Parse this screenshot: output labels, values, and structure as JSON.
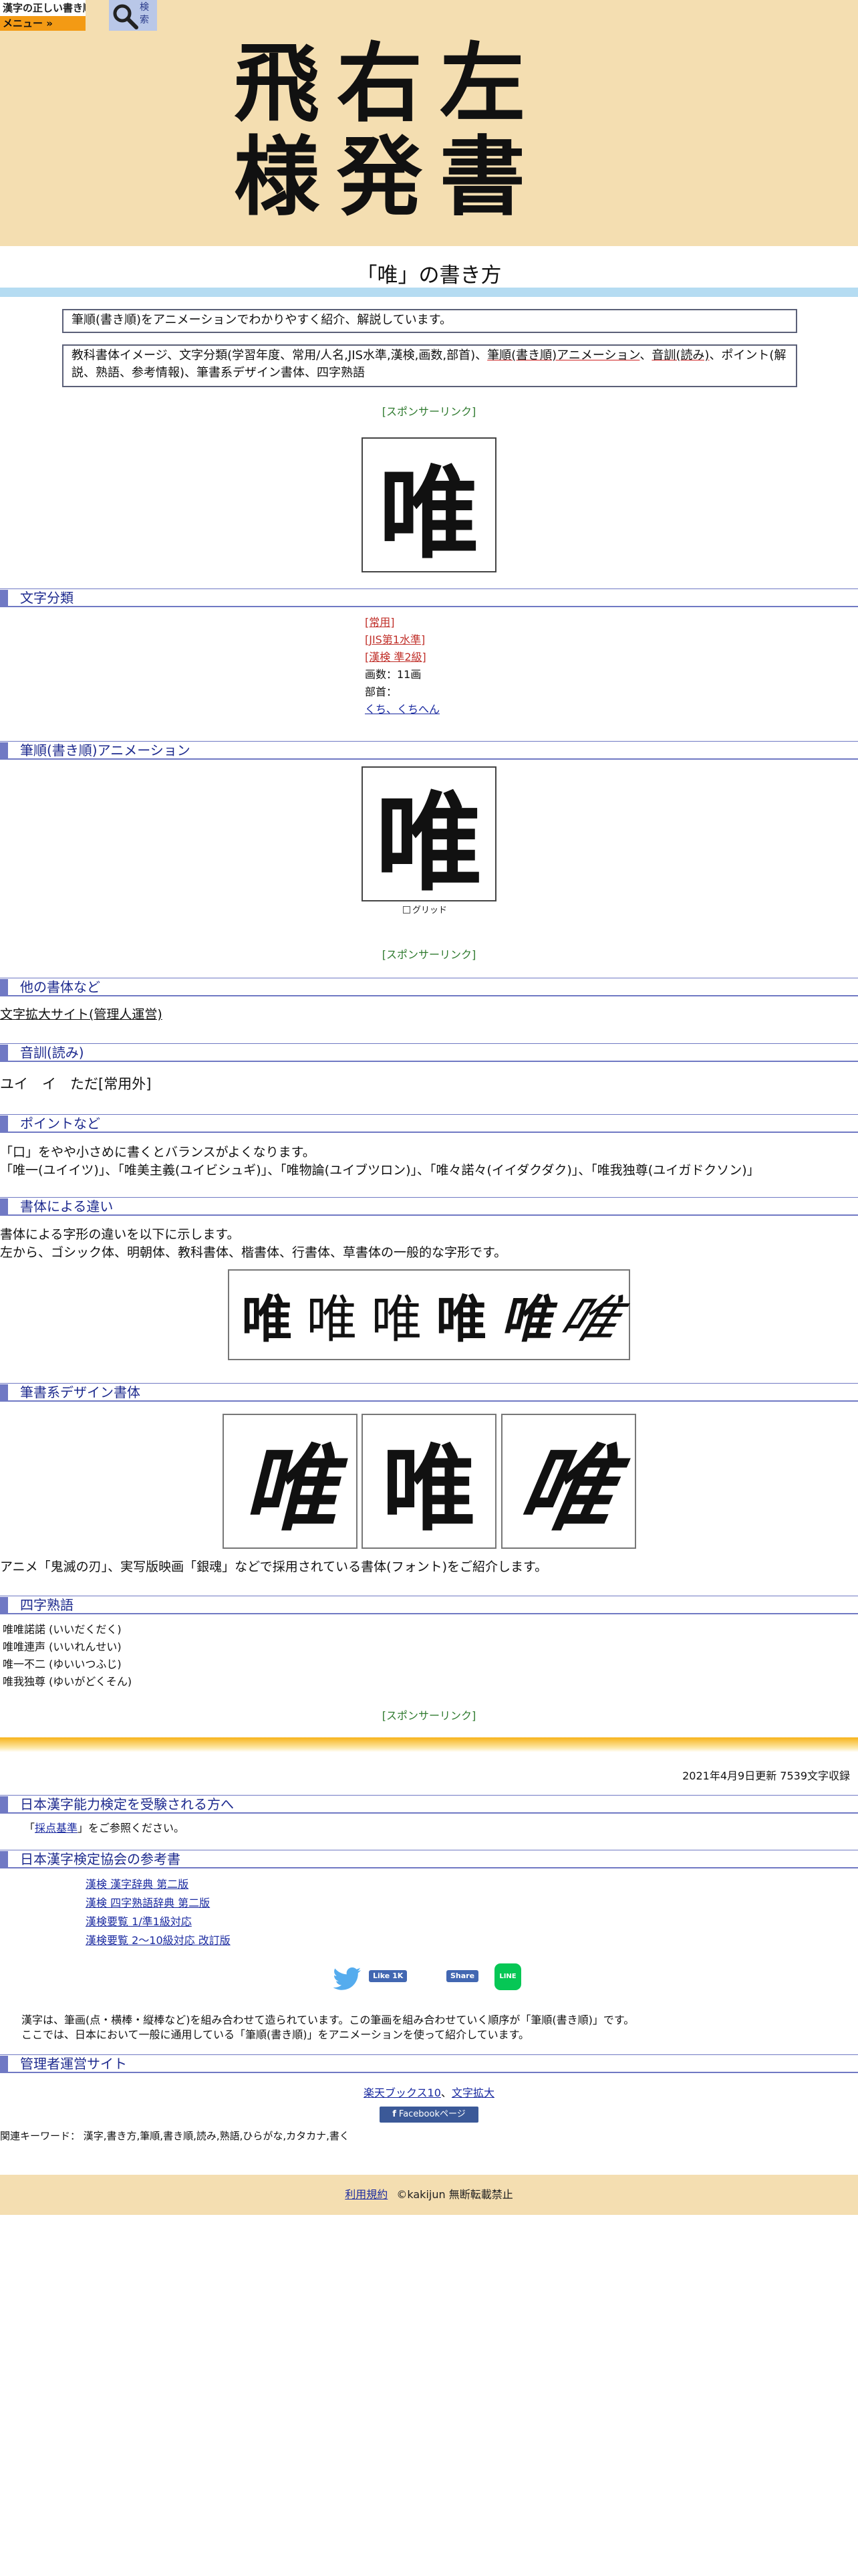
{
  "header": {
    "logo_line1": "漢字の正しい書き順(筆順)",
    "logo_line2": "メニュー »",
    "search_label": "検索",
    "chars_row1": "飛右左",
    "chars_row2": "様発書"
  },
  "title": "「唯」の書き方",
  "desc1": "筆順(書き順)をアニメーションでわかりやすく紹介、解説しています。",
  "desc2": {
    "a": "教科書体イメージ、文字分類(学習年度、常用/人名,JIS水準,漢検,画数,部首)、",
    "b": "筆順(書き順)アニメーション",
    "c": "、",
    "d": "音訓(読み)",
    "e": "、ポイント(解説、熟語、参考情報)、筆書系デザイン書体、四字熟語"
  },
  "sponsor": "[スポンサーリンク]",
  "kanji": "唯",
  "sections": {
    "classification": "文字分類",
    "animation": "筆順(書き順)アニメーション",
    "other_fonts": "他の書体など",
    "reading": "音訓(読み)",
    "points": "ポイントなど",
    "fonts_diff": "書体による違い",
    "brush": "筆書系デザイン書体",
    "yoji": "四字熟語",
    "kentei": "日本漢字能力検定を受験される方へ",
    "reference": "日本漢字検定協会の参考書",
    "admin": "管理者運営サイト"
  },
  "classification": {
    "joyo": "[常用]",
    "jis": "[JIS第1水準]",
    "kanken": "[漢検 準2級]",
    "strokes": "画数：11画",
    "radical_label": "部首：",
    "radical": "くち、くちへん"
  },
  "grid_label": "グリッド",
  "other_fonts_link": "文字拡大サイト(管理人運営)",
  "reading": "ユイ　イ　ただ[常用外]",
  "points": {
    "line1": "「口」をやや小さめに書くとバランスがよくなります。",
    "line2": "「唯一(ユイイツ)」、「唯美主義(ユイビシュギ)」、「唯物論(ユイブツロン)」、「唯々諾々(イイダクダク)」、「唯我独尊(ユイガドクソン)」"
  },
  "fonts_diff": {
    "line1": "書体による字形の違いを以下に示します。",
    "line2": "左から、ゴシック体、明朝体、教科書体、楷書体、行書体、草書体の一般的な字形です。"
  },
  "brush_caption": "アニメ「鬼滅の刃」、実写版映画「銀魂」などで採用されている書体(フォント)をご紹介します。",
  "yoji": [
    "唯唯諾諾 (いいだくだく)",
    "唯唯連声 (いいれんせい)",
    "唯一不二 (ゆいいつふじ)",
    "唯我独尊 (ゆいがどくそん)"
  ],
  "update": "2021年4月9日更新 7539文字収録",
  "kentei": {
    "pre": "「",
    "link": "採点基準",
    "post": "」をご参照ください。"
  },
  "reference_links": [
    "漢検 漢字辞典 第二版",
    "漢検 四字熟語辞典 第二版",
    "漢検要覧 1/準1級対応",
    "漢検要覧 2～10級対応 改訂版"
  ],
  "social": {
    "like": "Like 1K",
    "share": "Share",
    "line": "LINE"
  },
  "note_line1": "漢字は、筆画(点・横棒・縦棒など)を組み合わせて造られています。この筆画を組み合わせていく順序が「筆順(書き順)」です。",
  "note_line2": "ここでは、日本において一般に通用している「筆順(書き順)」をアニメーションを使って紹介しています。",
  "admin_links": {
    "rakuten": "楽天ブックス10",
    "sep": "、",
    "zoom": "文字拡大",
    "facebook": "Facebookページ"
  },
  "keywords": "関連キーワード： 漢字,書き方,筆順,書き順,読み,熟語,ひらがな,カタカナ,書く",
  "footer": {
    "terms": "利用規約",
    "copyright": "©kakijun 無断転載禁止"
  },
  "colors": {
    "header_bg": "#f4deb1",
    "section_accent": "#7079c4",
    "sponsor_green": "#2e7a2e",
    "title_bar": "#b5dcf2"
  }
}
